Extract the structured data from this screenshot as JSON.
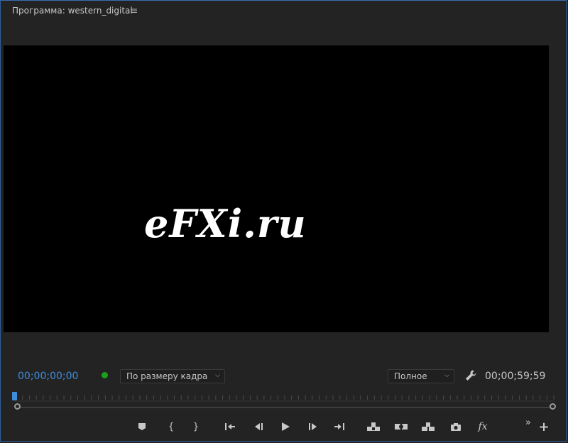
{
  "panel": {
    "title": "Программа: western_digital",
    "menu_icon": "hamburger-menu-icon"
  },
  "viewer": {
    "logo_text": "eFXi.ru"
  },
  "timecode": {
    "current": "00;00;00;00",
    "duration": "00;00;59;59"
  },
  "zoom_select": {
    "value": "По размеру кадра"
  },
  "quality_select": {
    "value": "Полное"
  },
  "colors": {
    "accent": "#3d8ddb",
    "status": "#1aa31a",
    "background": "#232323",
    "viewer": "#000000"
  },
  "controls": {
    "more_label": "»",
    "add_label": "+",
    "fx_label": "fx"
  }
}
